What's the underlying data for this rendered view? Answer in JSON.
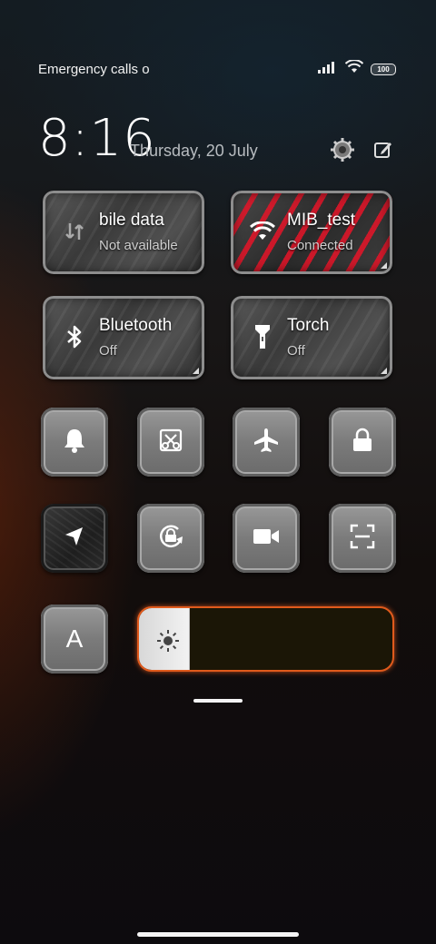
{
  "status": {
    "left_text": "Emergency calls o",
    "battery": "100",
    "icons": [
      "signal-icon",
      "wifi-icon",
      "battery-icon"
    ]
  },
  "header": {
    "time": "8:16",
    "date": "Thursday, 20 July",
    "icons": [
      "settings-icon",
      "edit-icon"
    ]
  },
  "tiles": [
    {
      "title": "bile data",
      "subtitle": "Not available",
      "icon": "mobile-data-icon",
      "active": false
    },
    {
      "title": "MIB_test",
      "subtitle": "Connected",
      "icon": "wifi-icon",
      "active": true
    },
    {
      "title": "Bluetooth",
      "subtitle": "Off",
      "icon": "bluetooth-icon",
      "active": false
    },
    {
      "title": "Torch",
      "subtitle": "Off",
      "icon": "torch-icon",
      "active": false
    }
  ],
  "toggles_row1": [
    {
      "name": "bell-icon",
      "active": true
    },
    {
      "name": "screenshot-crop-icon",
      "active": true
    },
    {
      "name": "airplane-icon",
      "active": true
    },
    {
      "name": "lock-icon",
      "active": true
    }
  ],
  "toggles_row2": [
    {
      "name": "location-icon",
      "active": false
    },
    {
      "name": "auto-rotate-icon",
      "active": true
    },
    {
      "name": "video-camera-icon",
      "active": true
    },
    {
      "name": "scan-icon",
      "active": true
    }
  ],
  "auto_brightness": {
    "label": "A"
  },
  "brightness": {
    "level": 0.2,
    "icon": "sun-icon",
    "accent": "#e05a1c"
  },
  "colors": {
    "active_wifi_tile": "#e01428",
    "slider_border": "#e05a1c"
  }
}
